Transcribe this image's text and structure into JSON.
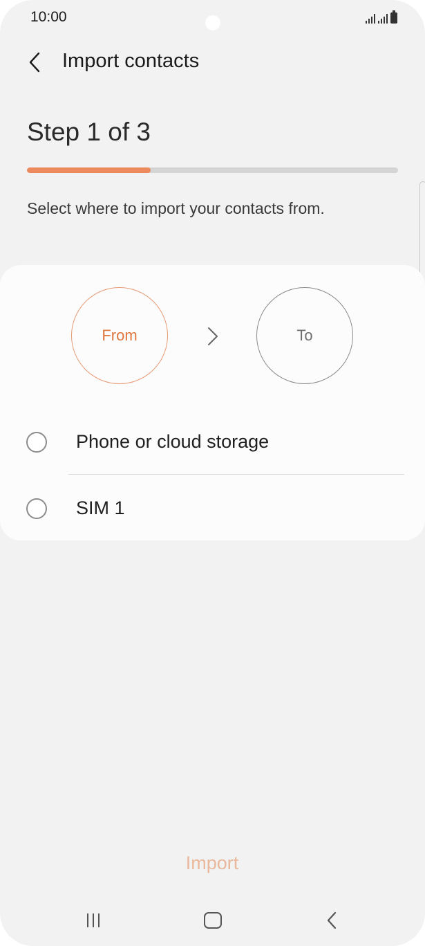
{
  "status_bar": {
    "time": "10:00"
  },
  "header": {
    "title": "Import contacts"
  },
  "wizard": {
    "step_text": "Step 1 of 3",
    "progress_fraction": 0.333,
    "instructions": "Select where to import your contacts from."
  },
  "flow": {
    "from_label": "From",
    "to_label": "To"
  },
  "options": [
    {
      "label": "Phone or cloud storage",
      "selected": false
    },
    {
      "label": "SIM 1",
      "selected": false
    }
  ],
  "actions": {
    "import_label": "Import"
  },
  "colors": {
    "accent": "#ec8a5e",
    "accent_text": "#e0773f",
    "import_disabled": "#eab89c",
    "background": "#f2f2f2",
    "card": "#fcfcfc"
  },
  "icons": {
    "back": "chevron-left-icon",
    "flow_arrow": "chevron-right-icon",
    "nav_recents": "recents-icon",
    "nav_home": "home-icon",
    "nav_back": "back-icon"
  }
}
